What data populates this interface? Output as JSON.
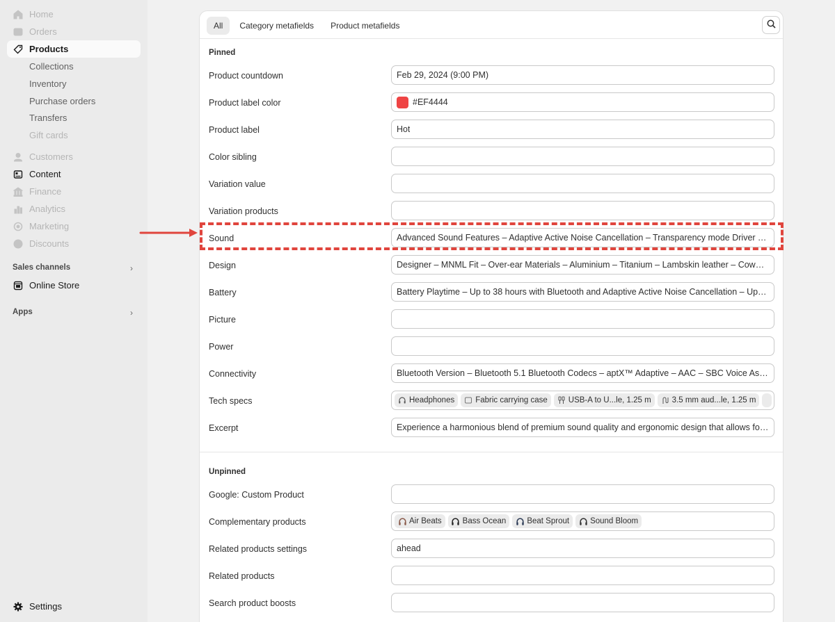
{
  "sidebar": {
    "nav": [
      {
        "label": "Home",
        "icon": "home-icon",
        "state": "dim"
      },
      {
        "label": "Orders",
        "icon": "orders-icon",
        "state": "dim"
      },
      {
        "label": "Products",
        "icon": "tag-icon",
        "state": "active"
      },
      {
        "label": "Customers",
        "icon": "person-icon",
        "state": "dim"
      },
      {
        "label": "Content",
        "icon": "content-icon",
        "state": "strong"
      },
      {
        "label": "Finance",
        "icon": "bank-icon",
        "state": "dim"
      },
      {
        "label": "Analytics",
        "icon": "bar-chart-icon",
        "state": "dim"
      },
      {
        "label": "Marketing",
        "icon": "target-icon",
        "state": "dim"
      },
      {
        "label": "Discounts",
        "icon": "discount-icon",
        "state": "dim"
      }
    ],
    "product_subitems": [
      "Collections",
      "Inventory",
      "Purchase orders",
      "Transfers",
      "Gift cards"
    ],
    "sales_channels_label": "Sales channels",
    "online_store_label": "Online Store",
    "apps_label": "Apps",
    "settings_label": "Settings"
  },
  "tabs": [
    "All",
    "Category metafields",
    "Product metafields"
  ],
  "active_tab": "All",
  "pinned": {
    "heading": "Pinned",
    "rows": [
      {
        "label": "Product countdown",
        "value": "Feb 29, 2024 (9:00 PM)"
      },
      {
        "label": "Product label color",
        "value": "#EF4444",
        "swatch": "#EF4444"
      },
      {
        "label": "Product label",
        "value": "Hot"
      },
      {
        "label": "Color sibling",
        "value": ""
      },
      {
        "label": "Variation value",
        "value": ""
      },
      {
        "label": "Variation products",
        "value": ""
      },
      {
        "label": "Sound",
        "value": "Advanced Sound Features – Adaptive Active Noise Cancellation – Transparency mode Driver Type..."
      },
      {
        "label": "Design",
        "value": "Designer – MNML Fit – Over-ear Materials – Aluminium – Titanium – Lambskin leather – Cowhide le"
      },
      {
        "label": "Battery",
        "value": "Battery Playtime – Up to 38 hours with Bluetooth and Adaptive Active Noise Cancellation – Up to 5..."
      },
      {
        "label": "Picture",
        "value": ""
      },
      {
        "label": "Power",
        "value": ""
      },
      {
        "label": "Connectivity",
        "value": "Bluetooth Version – Bluetooth 5.1 Bluetooth Codecs – aptX™ Adaptive – AAC – SBC Voice Assistant..."
      },
      {
        "label": "Tech specs",
        "chips": [
          "Headphones",
          "Fabric carrying case",
          "USB-A to U...le, 1.25 m",
          "3.5 mm aud...le, 1.25 m"
        ]
      },
      {
        "label": "Excerpt",
        "value": "Experience a harmonious blend of premium sound quality and ergonomic design that allows for a..."
      }
    ]
  },
  "unpinned": {
    "heading": "Unpinned",
    "rows": [
      {
        "label": "Google: Custom Product",
        "value": ""
      },
      {
        "label": "Complementary products",
        "chips": [
          "Air Beats",
          "Bass Ocean",
          "Beat Sprout",
          "Sound Bloom"
        ]
      },
      {
        "label": "Related products settings",
        "value": "ahead"
      },
      {
        "label": "Related products",
        "value": ""
      },
      {
        "label": "Search product boosts",
        "value": ""
      }
    ]
  },
  "annotation": {
    "highlighted_row": "Sound",
    "color": "#E0453D"
  }
}
